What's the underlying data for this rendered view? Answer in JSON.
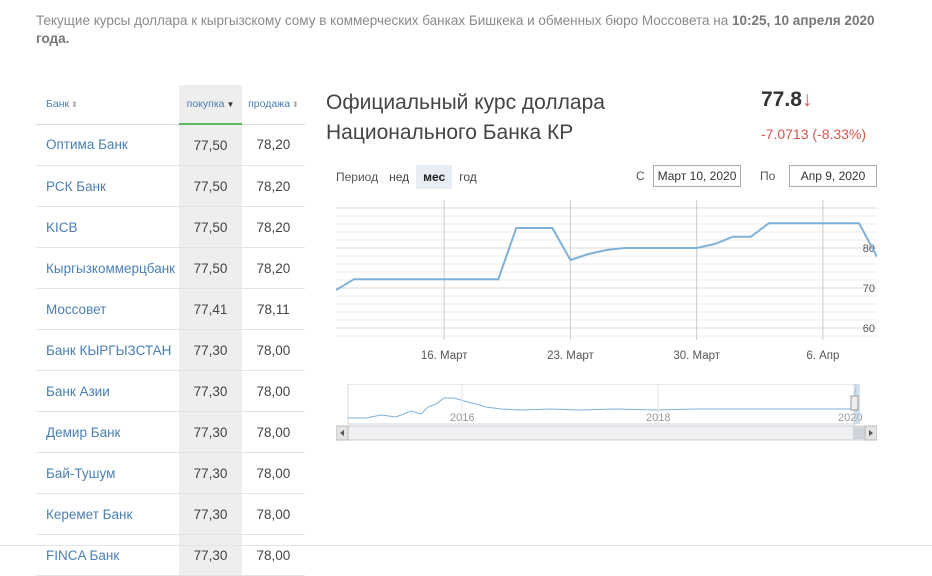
{
  "intro": {
    "text": "Текущие курсы доллара к кыргызскому сому в коммерческих банках Бишкека и обменных бюро Моссовета на ",
    "datetime": "10:25, 10 апреля 2020 года."
  },
  "table": {
    "headers": {
      "bank": "Банк",
      "buy": "покупка",
      "sell": "продажа"
    },
    "rows": [
      {
        "bank": "Оптима Банк",
        "buy": "77,50",
        "sell": "78,20"
      },
      {
        "bank": "РСК Банк",
        "buy": "77,50",
        "sell": "78,20"
      },
      {
        "bank": "KICB",
        "buy": "77,50",
        "sell": "78,20"
      },
      {
        "bank": "Кыргызкоммерцбанк",
        "buy": "77,50",
        "sell": "78,20"
      },
      {
        "bank": "Моссовет",
        "buy": "77,41",
        "sell": "78,11"
      },
      {
        "bank": "Банк КЫРГЫЗСТАН",
        "buy": "77,30",
        "sell": "78,00"
      },
      {
        "bank": "Банк Азии",
        "buy": "77,30",
        "sell": "78,00"
      },
      {
        "bank": "Демир Банк",
        "buy": "77,30",
        "sell": "78,00"
      },
      {
        "bank": "Бай-Тушум",
        "buy": "77,30",
        "sell": "78,00"
      },
      {
        "bank": "Керемет Банк",
        "buy": "77,30",
        "sell": "78,00"
      },
      {
        "bank": "FINCA Банк",
        "buy": "77,30",
        "sell": "78,00"
      }
    ]
  },
  "official": {
    "title_line1": "Официальный курс доллара",
    "title_line2": "Национального Банка КР",
    "rate": "77.8",
    "arrow": "↓",
    "change": "-7.0713 (-8.33%)"
  },
  "controls": {
    "period_label": "Период",
    "periods": [
      "нед",
      "мес",
      "год"
    ],
    "selected_period": "мес",
    "from_label": "С",
    "from_value": "Март 10, 2020",
    "to_label": "По",
    "to_value": "Апр 9, 2020"
  },
  "colors": {
    "line": "#7fb1d9",
    "link": "#4a7fb5",
    "down": "#d9534f",
    "active_tab": "#5cb85c"
  },
  "chart_data": {
    "type": "line",
    "x": [
      "2020-03-10",
      "2020-03-11",
      "2020-03-12",
      "2020-03-13",
      "2020-03-14",
      "2020-03-15",
      "2020-03-16",
      "2020-03-17",
      "2020-03-18",
      "2020-03-19",
      "2020-03-20",
      "2020-03-21",
      "2020-03-22",
      "2020-03-23",
      "2020-03-24",
      "2020-03-25",
      "2020-03-26",
      "2020-03-27",
      "2020-03-28",
      "2020-03-29",
      "2020-03-30",
      "2020-03-31",
      "2020-04-01",
      "2020-04-02",
      "2020-04-03",
      "2020-04-04",
      "2020-04-05",
      "2020-04-06",
      "2020-04-07",
      "2020-04-08",
      "2020-04-09"
    ],
    "values": [
      69.5,
      72.2,
      72.2,
      72.2,
      72.2,
      72.2,
      72.2,
      72.2,
      72.2,
      72.2,
      85.0,
      85.0,
      85.0,
      77.0,
      78.5,
      79.5,
      80.0,
      80.0,
      80.0,
      80.0,
      80.0,
      81.0,
      82.8,
      82.8,
      86.2,
      86.2,
      86.2,
      86.2,
      86.2,
      86.2,
      77.8
    ],
    "x_ticks": [
      "16. Март",
      "23. Март",
      "30. Март",
      "6. Апр"
    ],
    "y_ticks": [
      60,
      70,
      80
    ],
    "ylim": [
      57,
      92
    ],
    "grid": true,
    "navigator": {
      "labels": [
        "2016",
        "2018",
        "2020"
      ]
    }
  }
}
